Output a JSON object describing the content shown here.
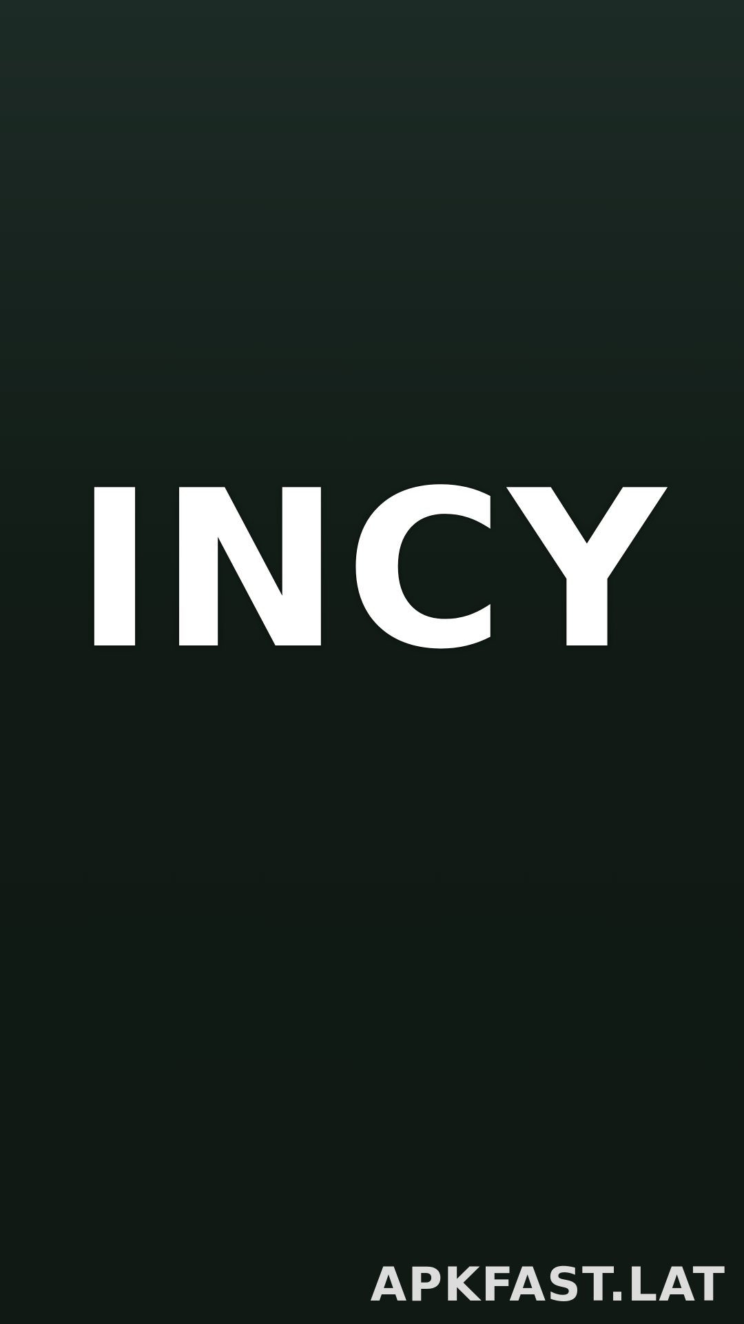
{
  "app": {
    "logo_text": "INCY"
  },
  "watermark": {
    "text": "APKFAST.LAT"
  },
  "colors": {
    "background_top": "#1d2b26",
    "background_bottom": "#101913",
    "logo": "#ffffff",
    "watermark": "#dcdcdc"
  }
}
